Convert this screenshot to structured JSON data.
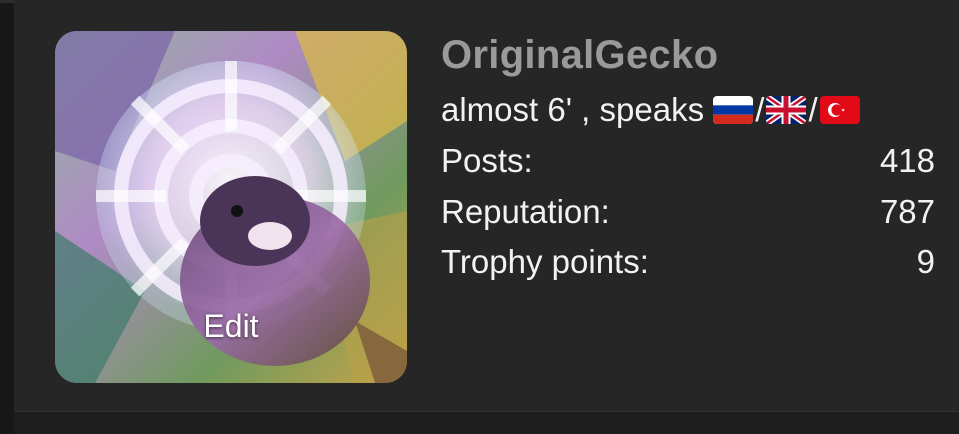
{
  "profile": {
    "username": "OriginalGecko",
    "title_text": "almost 6' , speaks",
    "flags": [
      "russia-flag-icon",
      "uk-flag-icon",
      "turkey-flag-icon"
    ],
    "flag_separator": "/",
    "avatar_action": "Edit"
  },
  "stats": [
    {
      "label": "Posts:",
      "value": "418"
    },
    {
      "label": "Reputation:",
      "value": "787"
    },
    {
      "label": "Trophy points:",
      "value": "9"
    }
  ],
  "colors": {
    "background": "#262626",
    "username": "#9a9a9a",
    "text": "#f2f2f2"
  }
}
